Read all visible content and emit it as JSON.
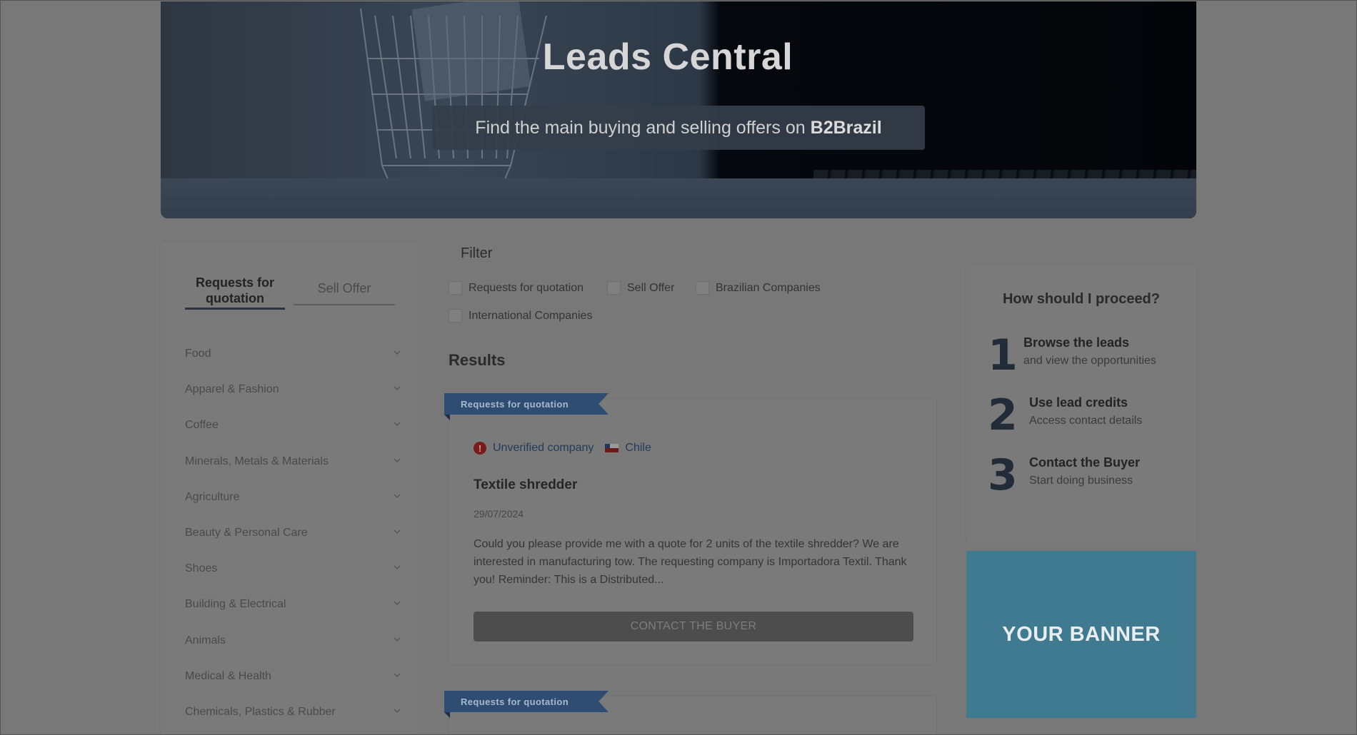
{
  "hero": {
    "title": "Leads Central",
    "subtitle_prefix": "Find the main buying and selling offers on",
    "subtitle_brand": "B2Brazil"
  },
  "sidebar": {
    "tabs": [
      {
        "label": "Requests for quotation",
        "active": true
      },
      {
        "label": "Sell Offer",
        "active": false
      }
    ],
    "categories": [
      "Food",
      "Apparel & Fashion",
      "Coffee",
      "Minerals, Metals & Materials",
      "Agriculture",
      "Beauty & Personal Care",
      "Shoes",
      "Building & Electrical",
      "Animals",
      "Medical & Health",
      "Chemicals, Plastics & Rubber"
    ]
  },
  "filter": {
    "title": "Filter",
    "options": [
      {
        "label": "Requests for quotation",
        "checked": false
      },
      {
        "label": "Sell Offer",
        "checked": false
      },
      {
        "label": "Brazilian Companies",
        "checked": false
      },
      {
        "label": "International Companies",
        "checked": false
      }
    ]
  },
  "results": {
    "title": "Results",
    "items": [
      {
        "type": "Requests for quotation",
        "verification": "Unverified company",
        "country": "Chile",
        "title": "Textile shredder",
        "date": "29/07/2024",
        "description": "Could you please provide me with a quote for 2 units of the textile shredder? We are interested in manufacturing tow. The requesting company is Importadora Textil. Thank you! Reminder: This is a Distributed...",
        "button": "CONTACT THE BUYER"
      },
      {
        "type": "Requests for quotation"
      }
    ]
  },
  "proceed": {
    "title": "How should I proceed?",
    "steps": [
      {
        "number": "1",
        "heading": "Browse the leads",
        "sub": "and view the opportunities"
      },
      {
        "number": "2",
        "heading": "Use lead credits",
        "sub": "Access contact details"
      },
      {
        "number": "3",
        "heading": "Contact the Buyer",
        "sub": "Start doing business"
      }
    ]
  },
  "banner": {
    "label": "YOUR BANNER",
    "color": "#3f7a91"
  },
  "colors": {
    "overlay": "#787878",
    "ribbon": "#2f4d72",
    "link": "#233a5a"
  }
}
